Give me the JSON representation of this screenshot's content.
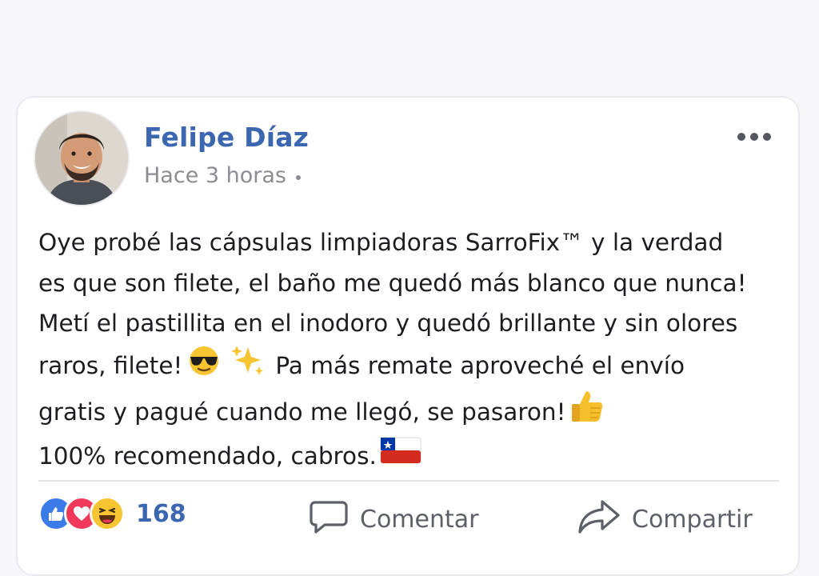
{
  "post": {
    "author": "Felipe Díaz",
    "timestamp": "Hace 3 horas",
    "body_lines": [
      "Oye probé las cápsulas limpiadoras SarroFix™ y la verdad",
      "es que son filete, el baño me quedó más blanco que nunca!",
      "Metí el pastillita en el inodoro y quedó brillante y sin olores",
      "raros, filete!",
      "Pa más remate aproveché el envío",
      "gratis y pagué cuando me llegó, se pasaron!",
      "100% recomendado, cabros."
    ],
    "emojis": [
      "sunglasses-emoji",
      "sparkles-emoji",
      "thumbs-up-emoji",
      "chile-flag-emoji"
    ]
  },
  "reactions": {
    "icons": [
      "like-icon",
      "love-icon",
      "haha-icon"
    ],
    "count": "168"
  },
  "actions": {
    "comment_label": "Comentar",
    "share_label": "Compartir"
  },
  "colors": {
    "author": "#3b66b0",
    "like": "#3b7be8",
    "love": "#f0385a",
    "haha": "#f7c531"
  }
}
